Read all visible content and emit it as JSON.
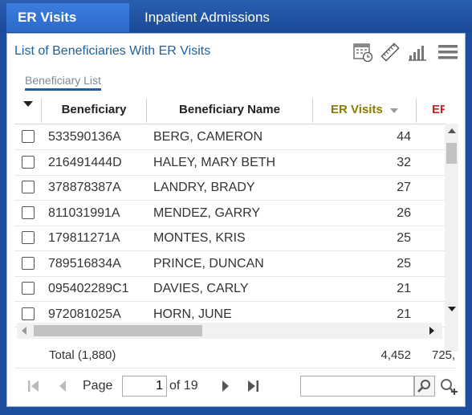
{
  "tabs": [
    {
      "label": "ER Visits",
      "active": true
    },
    {
      "label": "Inpatient Admissions",
      "active": false
    }
  ],
  "panel": {
    "title": "List of Beneficiaries With ER Visits",
    "subtab": "Beneficiary List",
    "toolbar_icons": [
      "calendar-clock-icon",
      "ruler-icon",
      "bar-chart-icon",
      "menu-icon"
    ]
  },
  "grid": {
    "columns": [
      "Beneficiary",
      "Beneficiary Name",
      "ER Visits",
      "ER C"
    ],
    "sorted_column": "ER Visits",
    "sort_direction": "descending",
    "colors": {
      "sorted_header": "#8a7a00",
      "partial_header": "#cc1f1f"
    },
    "rows": [
      {
        "id": "533590136A",
        "name": "BERG, CAMERON",
        "er": "44"
      },
      {
        "id": "216491444D",
        "name": "HALEY, MARY BETH",
        "er": "32"
      },
      {
        "id": "378878387A",
        "name": "LANDRY, BRADY",
        "er": "27"
      },
      {
        "id": "811031991A",
        "name": "MENDEZ, GARRY",
        "er": "26"
      },
      {
        "id": "179811271A",
        "name": "MONTES, KRIS",
        "er": "25"
      },
      {
        "id": "789516834A",
        "name": "PRINCE, DUNCAN",
        "er": "25"
      },
      {
        "id": "095402289C1",
        "name": "DAVIES, CARLY",
        "er": "21"
      },
      {
        "id": "972081025A",
        "name": "HORN, JUNE",
        "er": "21"
      }
    ],
    "total_label": "Total (1,880)",
    "total_er": "4,452",
    "total_partial": "725,"
  },
  "pager": {
    "page_label": "Page",
    "current_page": "1",
    "of_label": "of 19"
  }
}
